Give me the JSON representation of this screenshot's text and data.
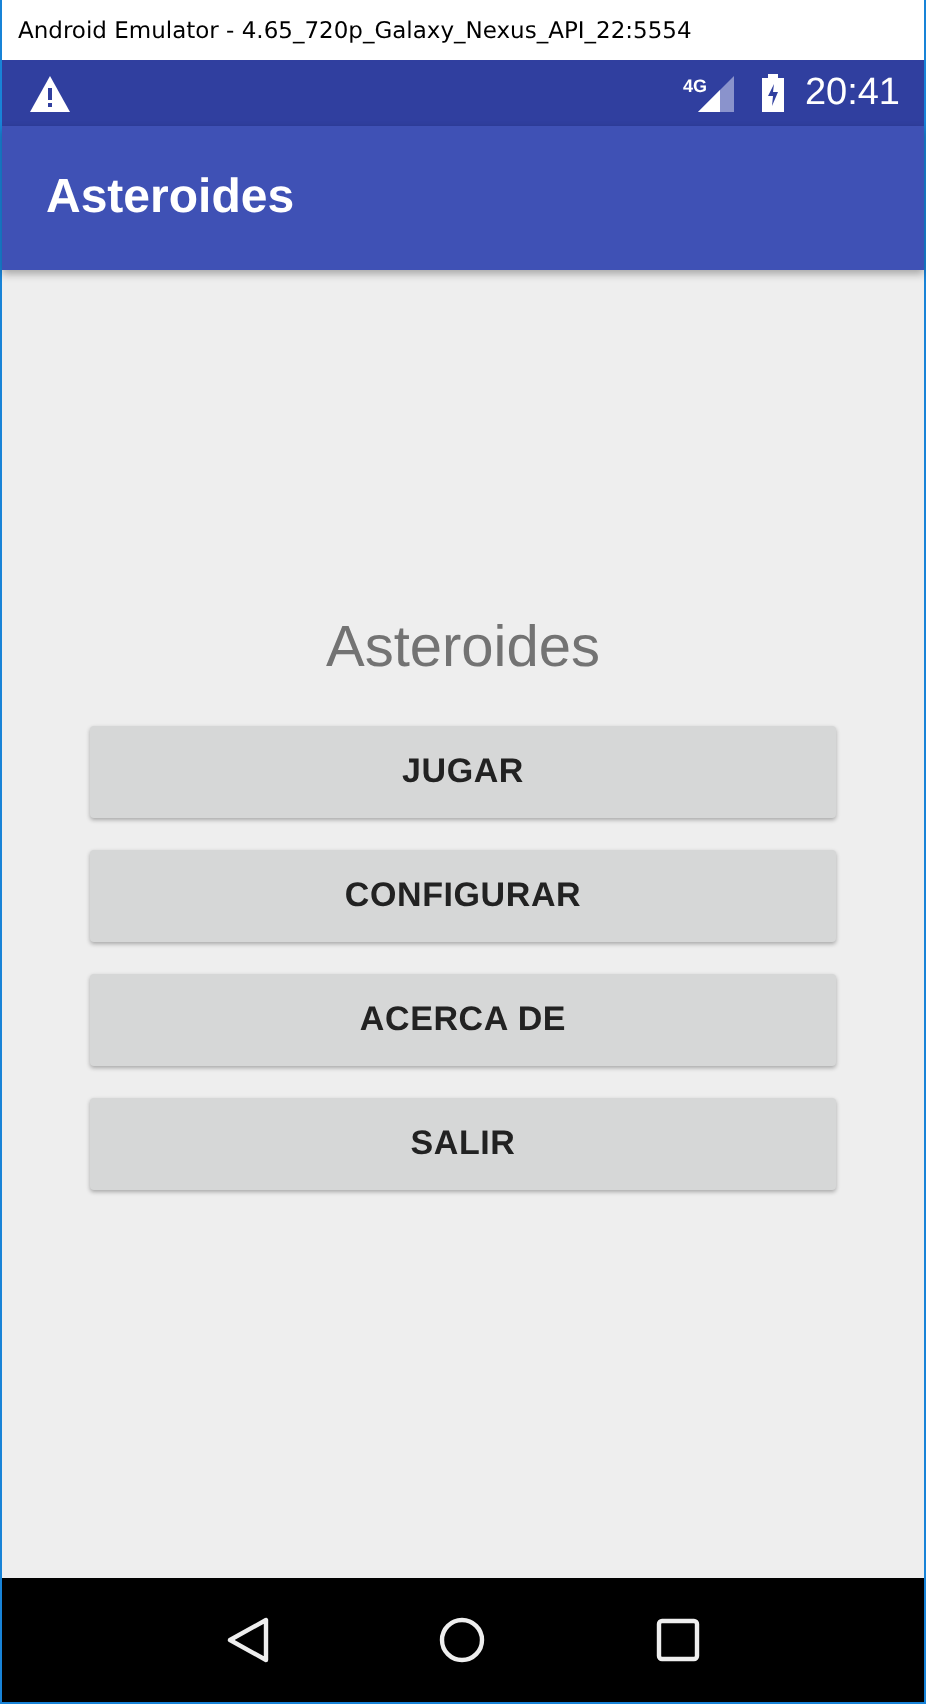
{
  "window": {
    "title": "Android Emulator - 4.65_720p_Galaxy_Nexus_API_22:5554"
  },
  "status_bar": {
    "network": "4G",
    "time": "20:41"
  },
  "app_bar": {
    "title": "Asteroides"
  },
  "main": {
    "heading": "Asteroides",
    "buttons": [
      {
        "label": "JUGAR"
      },
      {
        "label": "CONFIGURAR"
      },
      {
        "label": "ACERCA DE"
      },
      {
        "label": "SALIR"
      }
    ]
  }
}
